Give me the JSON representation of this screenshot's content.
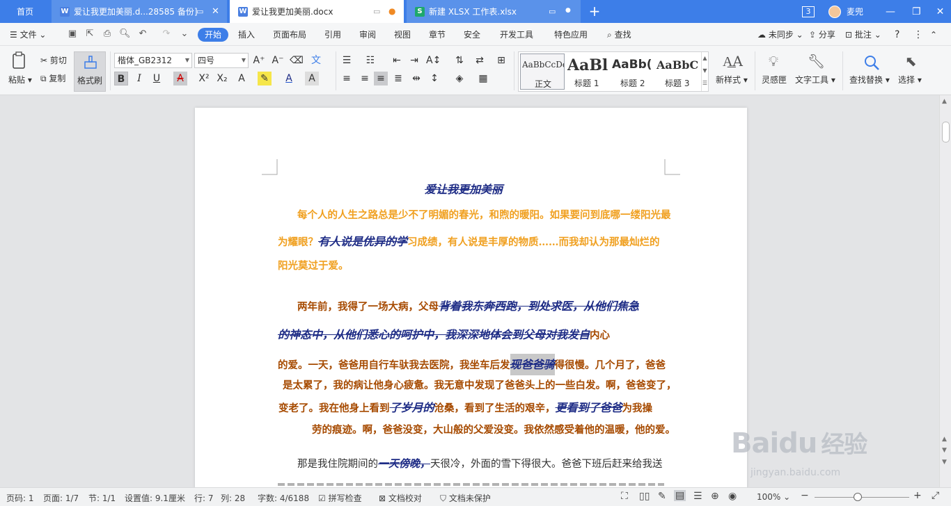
{
  "tabs": {
    "home": "首页",
    "tab1": "爱让我更加美丽.d...28585 备份]",
    "tab2": "爱让我更加美丽.docx",
    "tab3": "新建 XLSX 工作表.xlsx",
    "window_count": "3",
    "user": "麦兜"
  },
  "menu": {
    "file": "文件",
    "items": [
      "开始",
      "插入",
      "页面布局",
      "引用",
      "审阅",
      "视图",
      "章节",
      "安全",
      "开发工具",
      "特色应用"
    ],
    "search": "查找",
    "sync": "未同步",
    "share": "分享",
    "annotate": "批注"
  },
  "ribbon": {
    "paste": "粘贴",
    "cut": "剪切",
    "copy": "复制",
    "format_painter": "格式刷",
    "font_name": "楷体_GB2312",
    "font_size": "四号",
    "styles": [
      {
        "preview": "AaBbCcDd",
        "label": "正文"
      },
      {
        "preview": "AaBl",
        "label": "标题 1"
      },
      {
        "preview": "AaBb(",
        "label": "标题 2"
      },
      {
        "preview": "AaBbC",
        "label": "标题 3"
      }
    ],
    "new_style": "新样式",
    "inspiration": "灵感匣",
    "text_tools": "文字工具",
    "find_replace": "查找替换",
    "select": "选择"
  },
  "document": {
    "title": "爱让我更加美丽",
    "p1_l1": "每个人的人生之路总是少不了明媚的春光，和煦的暖阳。如果要问到底哪一缕阳光最",
    "p1_l2a": "为耀眼？",
    "p1_l2b": "有人说是优异的学",
    "p1_l2c": "习成绩，有人说是丰厚的物质……而我却认为那最灿烂的",
    "p1_l3": "阳光莫过于爱。",
    "p2_l1a": "两年前，我得了一场大病，父母",
    "p2_l1b": "背着我东奔西跑，到处求医，从他们焦急",
    "p2_l2a": "的神态中，从他们悉心的呵护中，我深深地体会到父母对我发自",
    "p2_l2b": "内心",
    "p2_l3a": "的爱。一天，爸爸用自行车驮我去医院，我坐车后发",
    "p2_l3b": "现爸爸骑",
    "p2_l3c": "得很慢。几个月了，爸爸",
    "p2_l4": "是太累了，我的病让他身心疲惫。我无意中发现了爸爸头上的一些白发。啊，爸爸变了，",
    "p2_l5a": "变老了。我在他身上看到",
    "p2_l5b": "了岁月的",
    "p2_l5c": "沧桑，看到了生活的艰辛，",
    "p2_l5d": "更看到了爸爸",
    "p2_l5e": "为我操",
    "p2_l6": "劳的痕迹。啊，爸爸没变，大山般的父爱没变。我依然感受着他的温暖，他的爱。",
    "p3_l1a": "那是我住院期间的",
    "p3_l1b": "一天傍晚，",
    "p3_l1c": "天很冷，外面的雪下得很大。爸爸下班后赶来给我送"
  },
  "status": {
    "page": "页码: 1",
    "pages": "页面: 1/7",
    "section": "节: 1/1",
    "setting": "设置值: 9.1厘米",
    "row": "行: 7",
    "col": "列: 28",
    "words": "字数: 4/6188",
    "spell": "拼写检查",
    "proof": "文档校对",
    "protect": "文档未保护",
    "zoom": "100%"
  },
  "watermark": {
    "brand": "Baidu",
    "brand_cn": "经验",
    "url": "jingyan.baidu.com"
  }
}
